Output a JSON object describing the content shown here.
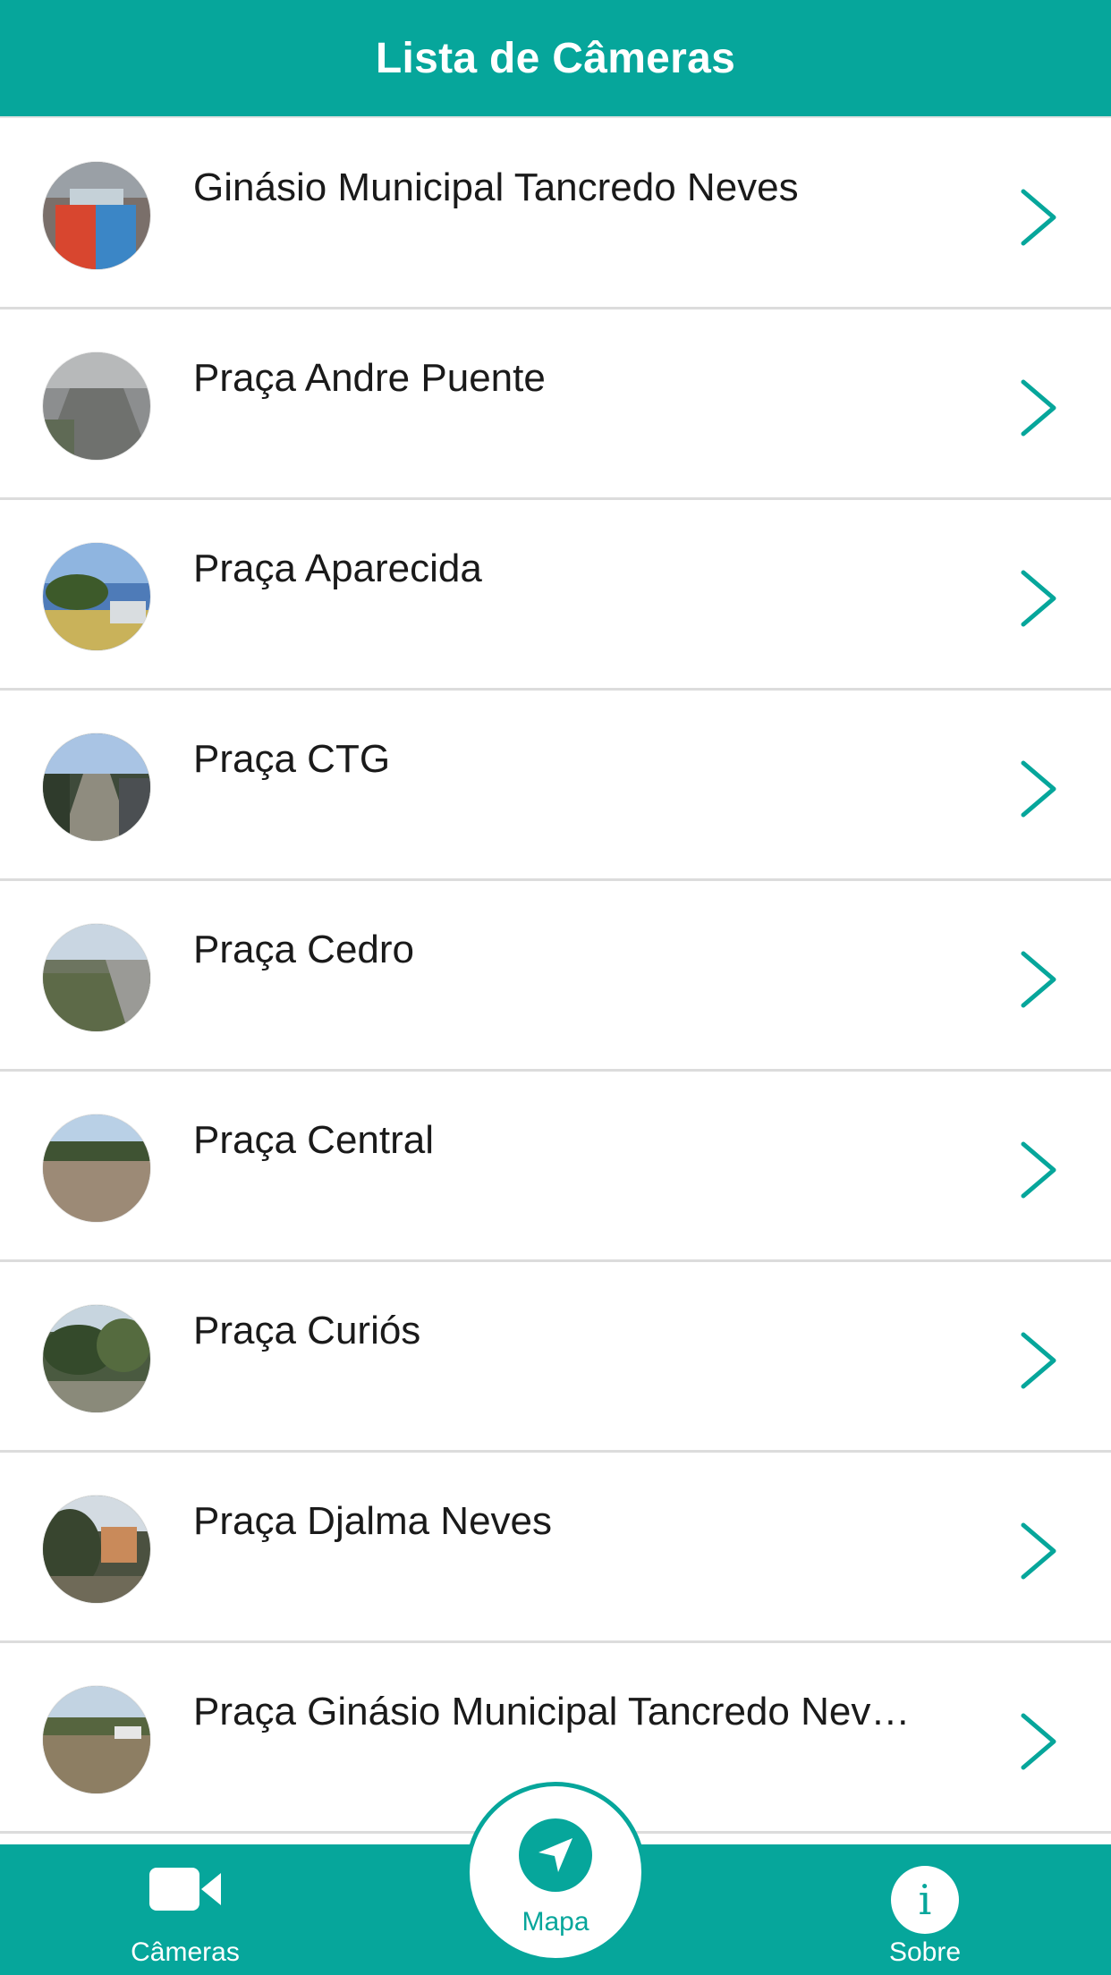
{
  "header": {
    "title": "Lista de Câmeras"
  },
  "cameras": [
    {
      "label": "Ginásio Municipal Tancredo Neves"
    },
    {
      "label": "Praça Andre Puente"
    },
    {
      "label": "Praça Aparecida"
    },
    {
      "label": "Praça CTG"
    },
    {
      "label": "Praça Cedro"
    },
    {
      "label": "Praça Central"
    },
    {
      "label": "Praça Curiós"
    },
    {
      "label": "Praça Djalma Neves"
    },
    {
      "label": "Praça Ginásio Municipal Tancredo Nev…"
    }
  ],
  "tabbar": {
    "cameras_label": "Câmeras",
    "map_label": "Mapa",
    "about_label": "Sobre"
  },
  "colors": {
    "accent": "#06a69b",
    "text": "#1a1a1a",
    "divider": "#dcdcdc"
  },
  "icons": {
    "row_arrow": "chevron-right-icon",
    "cameras_tab": "video-camera-icon",
    "map_tab": "navigation-arrow-icon",
    "about_tab": "info-icon"
  }
}
